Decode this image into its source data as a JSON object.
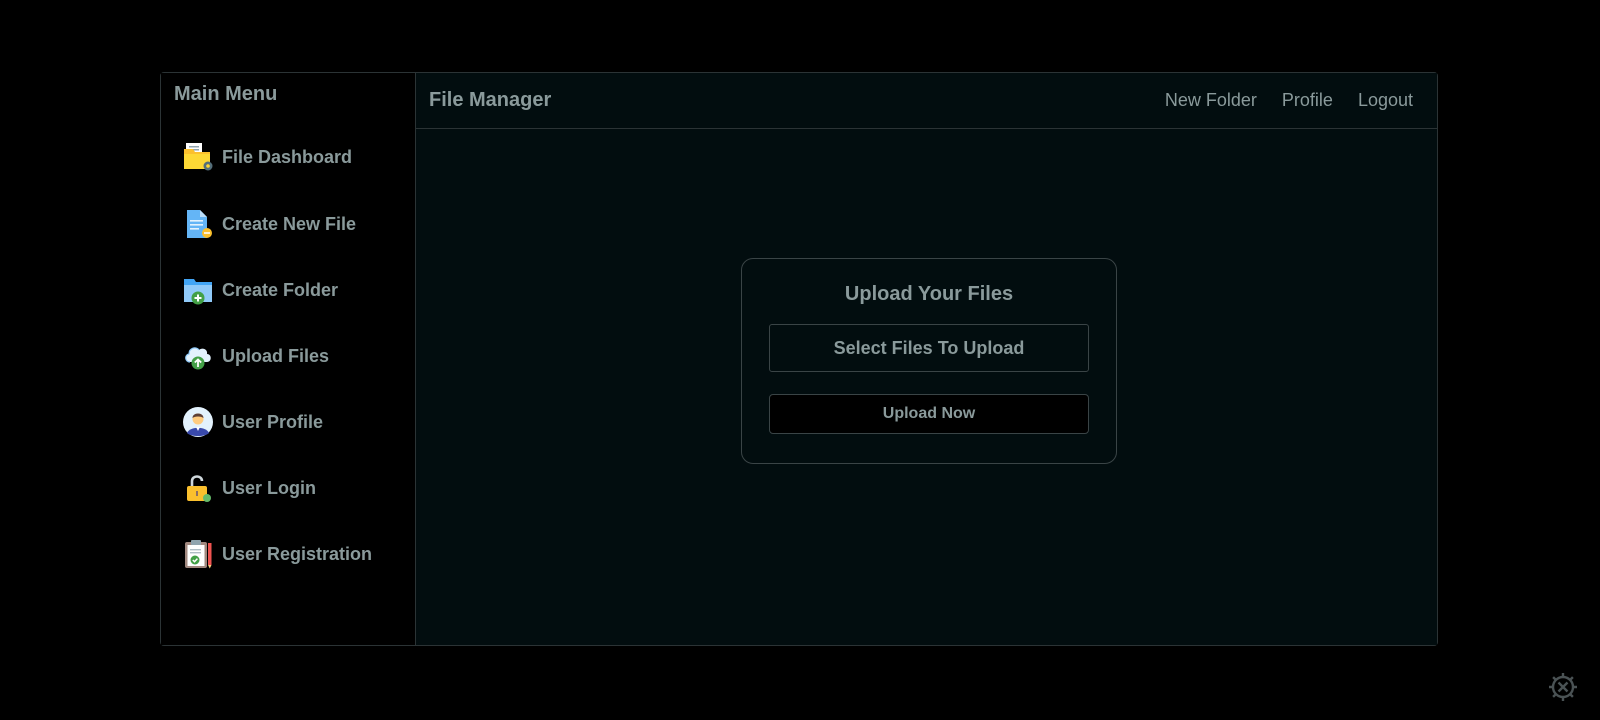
{
  "sidebar": {
    "title": "Main Menu",
    "items": [
      {
        "label": "File Dashboard",
        "icon": "folder-settings-icon"
      },
      {
        "label": "Create New File",
        "icon": "new-file-icon"
      },
      {
        "label": "Create Folder",
        "icon": "add-folder-icon"
      },
      {
        "label": "Upload Files",
        "icon": "cloud-upload-icon"
      },
      {
        "label": "User Profile",
        "icon": "user-avatar-icon"
      },
      {
        "label": "User Login",
        "icon": "unlock-icon"
      },
      {
        "label": "User Registration",
        "icon": "clipboard-check-icon"
      }
    ]
  },
  "header": {
    "title": "File Manager",
    "nav": [
      "New Folder",
      "Profile",
      "Logout"
    ]
  },
  "upload": {
    "title": "Upload Your Files",
    "select_label": "Select Files To Upload",
    "upload_label": "Upload Now"
  },
  "colors": {
    "background": "#000000",
    "panel": "#020d0f",
    "text": "#8a9a9b",
    "border": "#2b3335"
  }
}
